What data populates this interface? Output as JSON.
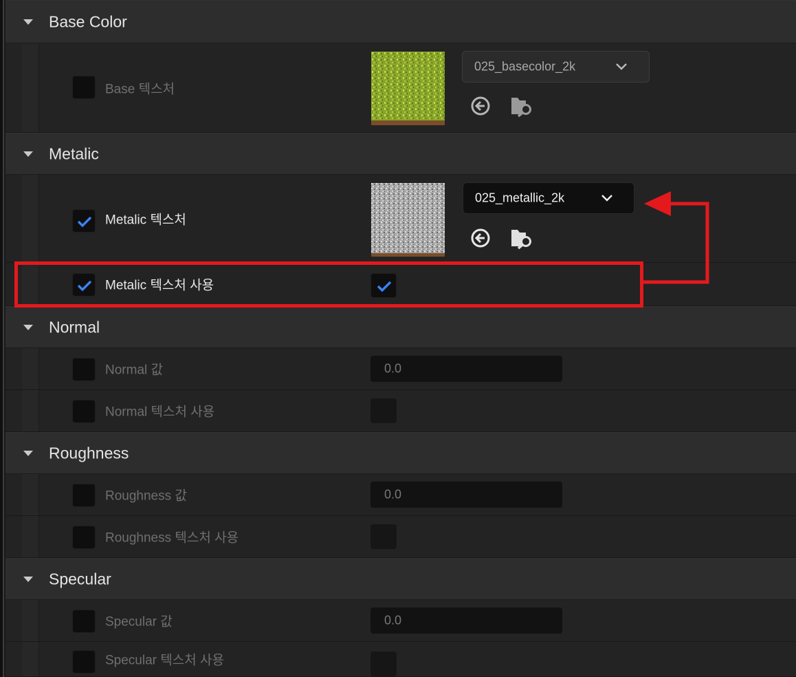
{
  "sections": {
    "base_color": {
      "title": "Base Color",
      "texture_label": "Base 텍스처",
      "texture_asset": "025_basecolor_2k"
    },
    "metalic": {
      "title": "Metalic",
      "texture_label": "Metalic 텍스처",
      "use_label": "Metalic 텍스처 사용",
      "texture_asset": "025_metallic_2k"
    },
    "normal": {
      "title": "Normal",
      "value_label": "Normal 값",
      "value": "0.0",
      "use_label": "Normal 텍스처 사용"
    },
    "roughness": {
      "title": "Roughness",
      "value_label": "Roughness 값",
      "value": "0.0",
      "use_label": "Roughness 텍스처 사용"
    },
    "specular": {
      "title": "Specular",
      "value_label": "Specular 값",
      "value": "0.0",
      "use_label": "Specular 텍스처 사용"
    }
  },
  "colors": {
    "panel": "#232323",
    "category": "#2d2d2d",
    "check_accent": "#3b82f6",
    "annotation": "#e4191c"
  },
  "icons": {
    "expand": "triangle-down-icon",
    "reset": "arrow-left-circle-icon",
    "browse": "folder-search-icon",
    "dropdown": "chevron-down-icon",
    "check": "checkmark-icon"
  }
}
